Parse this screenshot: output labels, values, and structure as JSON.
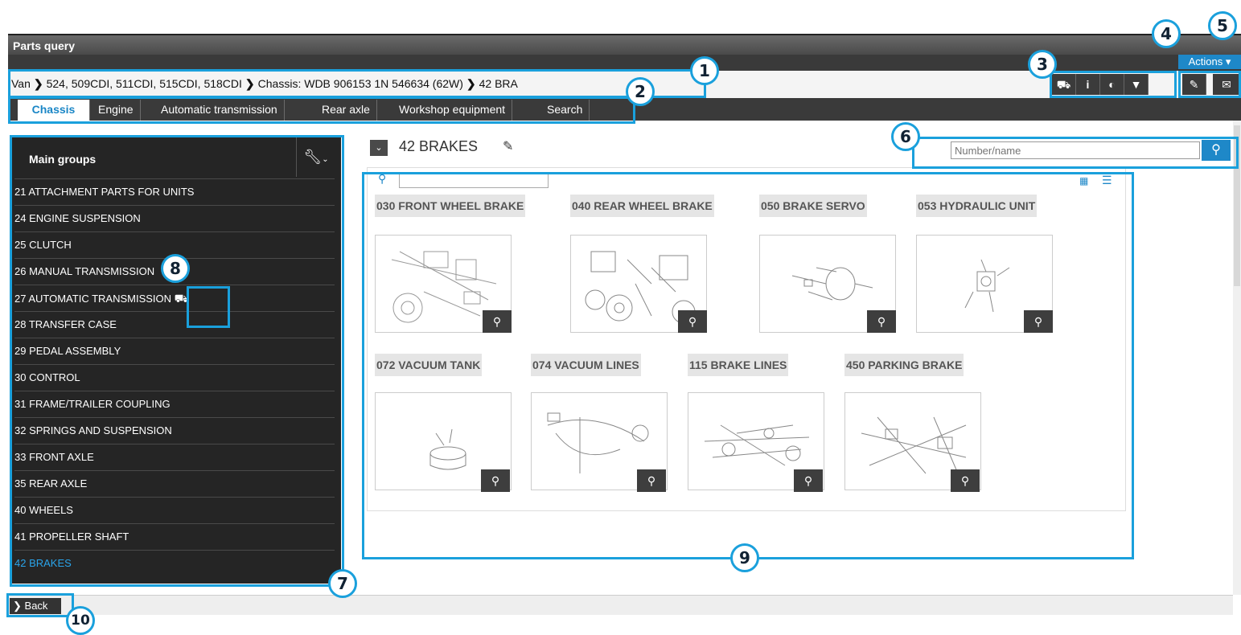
{
  "window": {
    "title": "Parts query",
    "actions_label": "Actions"
  },
  "breadcrumb": {
    "items": [
      "Van",
      "524, 509CDI, 511CDI, 515CDI, 518CDI",
      "Chassis: WDB 906153 1N 546634 (62W)",
      "42 BRA"
    ]
  },
  "toolbar": {
    "icons": [
      "vehicle-icon",
      "info-icon",
      "toggle-icon",
      "filter-icon",
      "edit-note-icon",
      "mail-icon"
    ],
    "glyphs": {
      "vehicle": "⛟",
      "info": "i",
      "toggle": "◐",
      "filter": "▼",
      "note": "✎",
      "mail": "✉"
    }
  },
  "tabs": [
    {
      "label": "Chassis",
      "active": true
    },
    {
      "label": "Engine"
    },
    {
      "label": "Automatic transmission"
    },
    {
      "label": "Rear axle"
    },
    {
      "label": "Workshop equipment"
    },
    {
      "label": "Search"
    }
  ],
  "sidebar": {
    "title": "Main groups",
    "items": [
      "21 ATTACHMENT PARTS FOR UNITS",
      "24 ENGINE SUSPENSION",
      "25 CLUTCH",
      "26 MANUAL TRANSMISSION",
      "27 AUTOMATIC TRANSMISSION",
      "28 TRANSFER CASE",
      "29 PEDAL ASSEMBLY",
      "30 CONTROL",
      "31 FRAME/TRAILER COUPLING",
      "32 SPRINGS AND SUSPENSION",
      "33 FRONT AXLE",
      "35 REAR AXLE",
      "40 WHEELS",
      "41 PROPELLER SHAFT",
      "42 BRAKES"
    ],
    "active": "42 BRAKES"
  },
  "main": {
    "group_title": "42 BRAKES",
    "search_placeholder": "Number/name",
    "subgroups": [
      "030 FRONT WHEEL BRAKE",
      "040 REAR WHEEL BRAKE",
      "050 BRAKE SERVO",
      "053 HYDRAULIC UNIT",
      "072 VACUUM TANK",
      "074 VACUUM LINES",
      "115 BRAKE LINES",
      "450 PARKING BRAKE"
    ]
  },
  "footer": {
    "back_label": "Back"
  },
  "callouts": [
    "1",
    "2",
    "3",
    "4",
    "5",
    "6",
    "7",
    "8",
    "9",
    "10"
  ],
  "colors": {
    "accent": "#1aa0dc",
    "button": "#1e88c8",
    "dark": "#252525"
  }
}
